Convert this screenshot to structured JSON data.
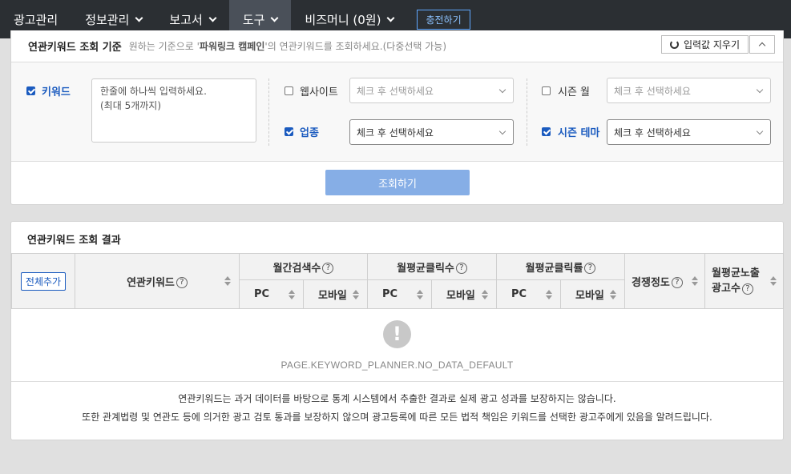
{
  "nav": {
    "items": [
      {
        "label": "광고관리",
        "chevron": false,
        "active": false
      },
      {
        "label": "정보관리",
        "chevron": true,
        "active": false
      },
      {
        "label": "보고서",
        "chevron": true,
        "active": false
      },
      {
        "label": "도구",
        "chevron": true,
        "active": true
      },
      {
        "label": "비즈머니 (0원)",
        "chevron": true,
        "active": false
      }
    ],
    "charge_label": "충전하기"
  },
  "criteria": {
    "title": "연관키워드 조회 기준",
    "desc_prefix": "원하는 기준으로 '",
    "desc_bold": "파워링크 캠페인",
    "desc_suffix": "'의 연관키워드를 조회하세요.(다중선택 가능)",
    "reset_label": "입력값 지우기",
    "keyword": {
      "label": "키워드",
      "checked": true,
      "placeholder": "한줄에 하나씩 입력하세요.\n(최대 5개까지)"
    },
    "website": {
      "label": "웹사이트",
      "checked": false,
      "placeholder": "체크 후 선택하세요"
    },
    "industry": {
      "label": "업종",
      "checked": true,
      "placeholder": "체크 후 선택하세요"
    },
    "season_month": {
      "label": "시즌 월",
      "checked": false,
      "placeholder": "체크 후 선택하세요"
    },
    "season_theme": {
      "label": "시즌 테마",
      "checked": true,
      "placeholder": "체크 후 선택하세요"
    },
    "search_label": "조회하기"
  },
  "results": {
    "title": "연관키워드 조회 결과",
    "add_all_label": "전체추가",
    "columns": {
      "keyword": "연관키워드",
      "monthly_search": "월간검색수",
      "avg_clicks": "월평균클릭수",
      "avg_ctr": "월평균클릭률",
      "competition": "경쟁정도",
      "avg_ads_line1": "월평균노출",
      "avg_ads_line2": "광고수",
      "pc": "PC",
      "mobile": "모바일"
    },
    "no_data_icon": "!",
    "no_data_text": "PAGE.KEYWORD_PLANNER.NO_DATA_DEFAULT",
    "notice_line1": "연관키워드는 과거 데이터를 바탕으로 통계 시스템에서 추출한 결과로 실제 광고 성과를 보장하지는 않습니다.",
    "notice_line2": "또한 관계법령 및 연관도 등에 의거한 광고 검토 통과를 보장하지 않으며 광고등록에 따른 모든 법적 책임은 키워드를 선택한 광고주에게 있음을 알려드립니다."
  },
  "colors": {
    "nav_bg": "#2b2f33",
    "accent": "#1b5bbf",
    "search_button": "#86aee6"
  }
}
